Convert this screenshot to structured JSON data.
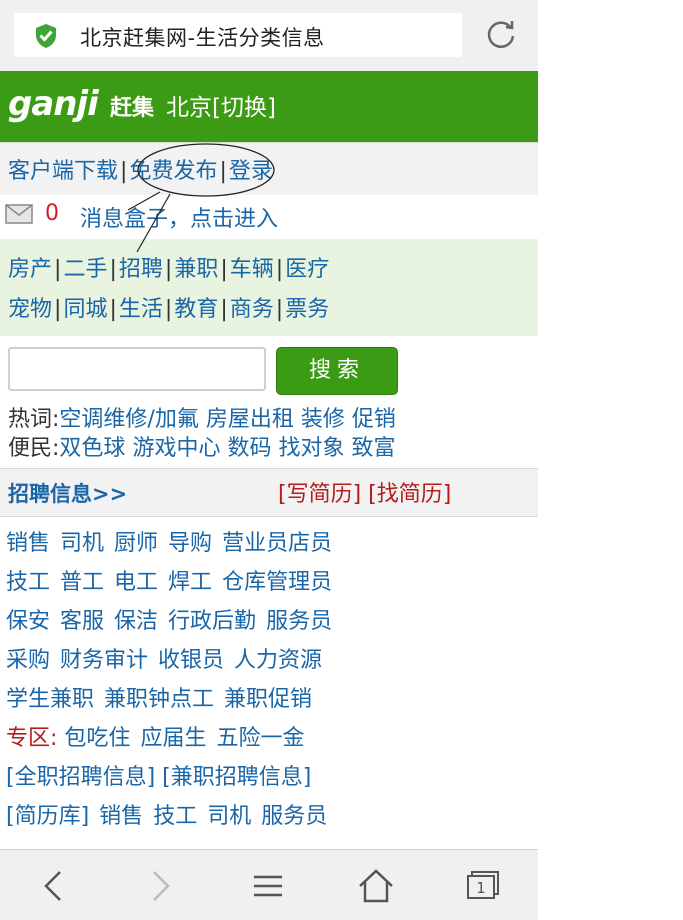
{
  "browser": {
    "tab_title": "北京赶集网-生活分类信息"
  },
  "header": {
    "logo_text": "ganji",
    "logo_cn": "赶集",
    "city": "北京[切换]",
    "brand_color": "#3c9b14"
  },
  "toplinks": {
    "download": "客户端下载",
    "post_free": "免费发布",
    "login": "登录"
  },
  "messages": {
    "count": "0",
    "text": "消息盒子，点击进入"
  },
  "categories": {
    "row1": [
      "房产",
      "二手",
      "招聘",
      "兼职",
      "车辆",
      "医疗"
    ],
    "row2": [
      "宠物",
      "同城",
      "生活",
      "教育",
      "商务",
      "票务"
    ]
  },
  "search": {
    "placeholder": "",
    "button": "搜索"
  },
  "hotwords": {
    "label": "热词:",
    "items": [
      "空调维修/加氟",
      "房屋出租",
      "装修",
      "促销"
    ]
  },
  "bianmin": {
    "label": "便民:",
    "items": [
      "双色球",
      "游戏中心",
      "数码",
      "找对象",
      "致富"
    ]
  },
  "jobs": {
    "title": "招聘信息>>",
    "write_resume": "[写简历]",
    "find_resume": "[找简历]",
    "rows": [
      [
        "销售",
        "司机",
        "厨师",
        "导购",
        "营业员店员"
      ],
      [
        "技工",
        "普工",
        "电工",
        "焊工",
        "仓库管理员"
      ],
      [
        "保安",
        "客服",
        "保洁",
        "行政后勤",
        "服务员"
      ],
      [
        "采购",
        "财务审计",
        "收银员",
        "人力资源"
      ],
      [
        "学生兼职",
        "兼职钟点工",
        "兼职促销"
      ]
    ],
    "zone_label": "专区:",
    "zone_items": [
      "包吃住",
      "应届生",
      "五险一金"
    ],
    "row_links": [
      "[全职招聘信息]",
      "[兼职招聘信息]"
    ],
    "resume_row": [
      "[简历库]",
      "销售",
      "技工",
      "司机",
      "服务员"
    ]
  },
  "toolbar": {
    "tab_count": "1"
  }
}
